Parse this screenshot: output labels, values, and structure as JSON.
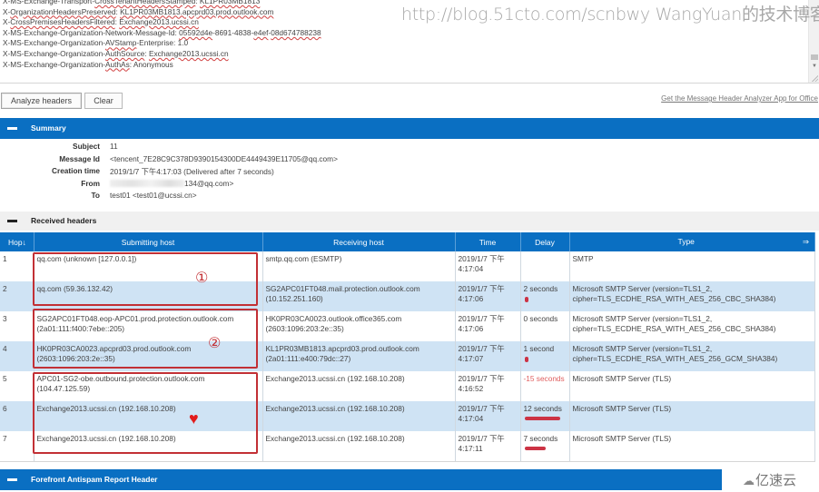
{
  "header_input": {
    "lines": [
      [
        {
          "t": "X-MS-Exchange-Transport-"
        },
        {
          "t": "CrossTenantHeadersStamped",
          "u": true
        },
        {
          "t": ": "
        },
        {
          "t": "KL1PR03MB1813",
          "u": true
        }
      ],
      [
        {
          "t": "X-"
        },
        {
          "t": "OrganizationHeadersPreserved",
          "u": true
        },
        {
          "t": ": "
        },
        {
          "t": "KL1PR03MB1813.apcprd03.prod.outlook.com",
          "u": true
        }
      ],
      [
        {
          "t": "X-"
        },
        {
          "t": "CrossPremisesHeadersFiltered",
          "u": true
        },
        {
          "t": ": "
        },
        {
          "t": "Exchange2013.ucssi.cn",
          "u": true
        }
      ],
      [
        {
          "t": "X-MS-Exchange-Organization-Network-Message-Id: "
        },
        {
          "t": "05592d4e",
          "u": true
        },
        {
          "t": "-8691-4838-"
        },
        {
          "t": "e4ef",
          "u": true
        },
        {
          "t": "-"
        },
        {
          "t": "08d674788238",
          "u": true
        }
      ],
      [
        {
          "t": "X-MS-Exchange-Organization-"
        },
        {
          "t": "AVStamp",
          "u": true
        },
        {
          "t": "-Enterprise: 1.0"
        }
      ],
      [
        {
          "t": "X-MS-Exchange-Organization-"
        },
        {
          "t": "AuthSource",
          "u": true
        },
        {
          "t": ": "
        },
        {
          "t": "Exchange2013.ucssi.cn",
          "u": true
        }
      ],
      [
        {
          "t": "X-MS-Exchange-Organization-"
        },
        {
          "t": "AuthAs",
          "u": true
        },
        {
          "t": ": Anonymous"
        }
      ]
    ]
  },
  "watermark": "http://blog.51cto.com/scnbwy WangYuan的技术博客",
  "toolbar": {
    "analyze_label": "Analyze headers",
    "clear_label": "Clear",
    "app_link": "Get the Message Header Analyzer App for Office"
  },
  "summary": {
    "title": "Summary",
    "rows": [
      {
        "label": "Subject",
        "value": "11"
      },
      {
        "label": "Message Id",
        "value": "<tencent_7E28C9C378D9390154300DE4449439E11705@qq.com>"
      },
      {
        "label": "Creation time",
        "value": "2019/1/7 下午4:17:03 (Delivered after 7 seconds)"
      },
      {
        "label": "From",
        "value": "134@qq.com>"
      },
      {
        "label": "To",
        "value": "test01 <test01@ucssi.cn>"
      }
    ]
  },
  "received": {
    "title": "Received headers",
    "columns": [
      "Hop↓",
      "Submitting host",
      "Receiving host",
      "Time",
      "Delay",
      "Type"
    ],
    "expand_arrow": "⇒",
    "rows": [
      {
        "hop": "1",
        "submitting": "qq.com (unknown [127.0.0.1])",
        "receiving": "smtp.qq.com (ESMTP)",
        "time": "2019/1/7 下午 4:17:04",
        "delay": "",
        "delay_seconds": 0,
        "type": "SMTP"
      },
      {
        "hop": "2",
        "submitting": "qq.com (59.36.132.42)",
        "receiving": "SG2APC01FT048.mail.protection.outlook.com (10.152.251.160)",
        "time": "2019/1/7 下午 4:17:06",
        "delay": "2 seconds",
        "delay_seconds": 2,
        "type": "Microsoft SMTP Server (version=TLS1_2, cipher=TLS_ECDHE_RSA_WITH_AES_256_CBC_SHA384)"
      },
      {
        "hop": "3",
        "submitting": "SG2APC01FT048.eop-APC01.prod.protection.outlook.com (2a01:111:f400:7ebe::205)",
        "receiving": "HK0PR03CA0023.outlook.office365.com (2603:1096:203:2e::35)",
        "time": "2019/1/7 下午 4:17:06",
        "delay": "0 seconds",
        "delay_seconds": 0,
        "type": "Microsoft SMTP Server (version=TLS1_2, cipher=TLS_ECDHE_RSA_WITH_AES_256_CBC_SHA384)"
      },
      {
        "hop": "4",
        "submitting": "HK0PR03CA0023.apcprd03.prod.outlook.com (2603:1096:203:2e::35)",
        "receiving": "KL1PR03MB1813.apcprd03.prod.outlook.com (2a01:111:e400:79dc::27)",
        "time": "2019/1/7 下午 4:17:07",
        "delay": "1 second",
        "delay_seconds": 1,
        "type": "Microsoft SMTP Server (version=TLS1_2, cipher=TLS_ECDHE_RSA_WITH_AES_256_GCM_SHA384)"
      },
      {
        "hop": "5",
        "submitting": "APC01-SG2-obe.outbound.protection.outlook.com (104.47.125.59)",
        "receiving": "Exchange2013.ucssi.cn (192.168.10.208)",
        "time": "2019/1/7 下午 4:16:52",
        "delay": "-15 seconds",
        "delay_seconds": -15,
        "type": "Microsoft SMTP Server (TLS)"
      },
      {
        "hop": "6",
        "submitting": "Exchange2013.ucssi.cn (192.168.10.208)",
        "receiving": "Exchange2013.ucssi.cn (192.168.10.208)",
        "time": "2019/1/7 下午 4:17:04",
        "delay": "12 seconds",
        "delay_seconds": 12,
        "type": "Microsoft SMTP Server (TLS)"
      },
      {
        "hop": "7",
        "submitting": "Exchange2013.ucssi.cn (192.168.10.208)",
        "receiving": "Exchange2013.ucssi.cn (192.168.10.208)",
        "time": "2019/1/7 下午 4:17:11",
        "delay": "7 seconds",
        "delay_seconds": 7,
        "type": "Microsoft SMTP Server (TLS)"
      }
    ]
  },
  "annotations": {
    "group1": "①",
    "group2": "②",
    "group3_icon": "heart"
  },
  "forefront": {
    "title": "Forefront Antispam Report Header"
  },
  "logo": {
    "text": "亿速云"
  },
  "colors": {
    "accent": "#0a6fc2",
    "alt_row": "#cfe3f4",
    "annotation": "#c23035",
    "delay_bar": "#cc3344"
  }
}
